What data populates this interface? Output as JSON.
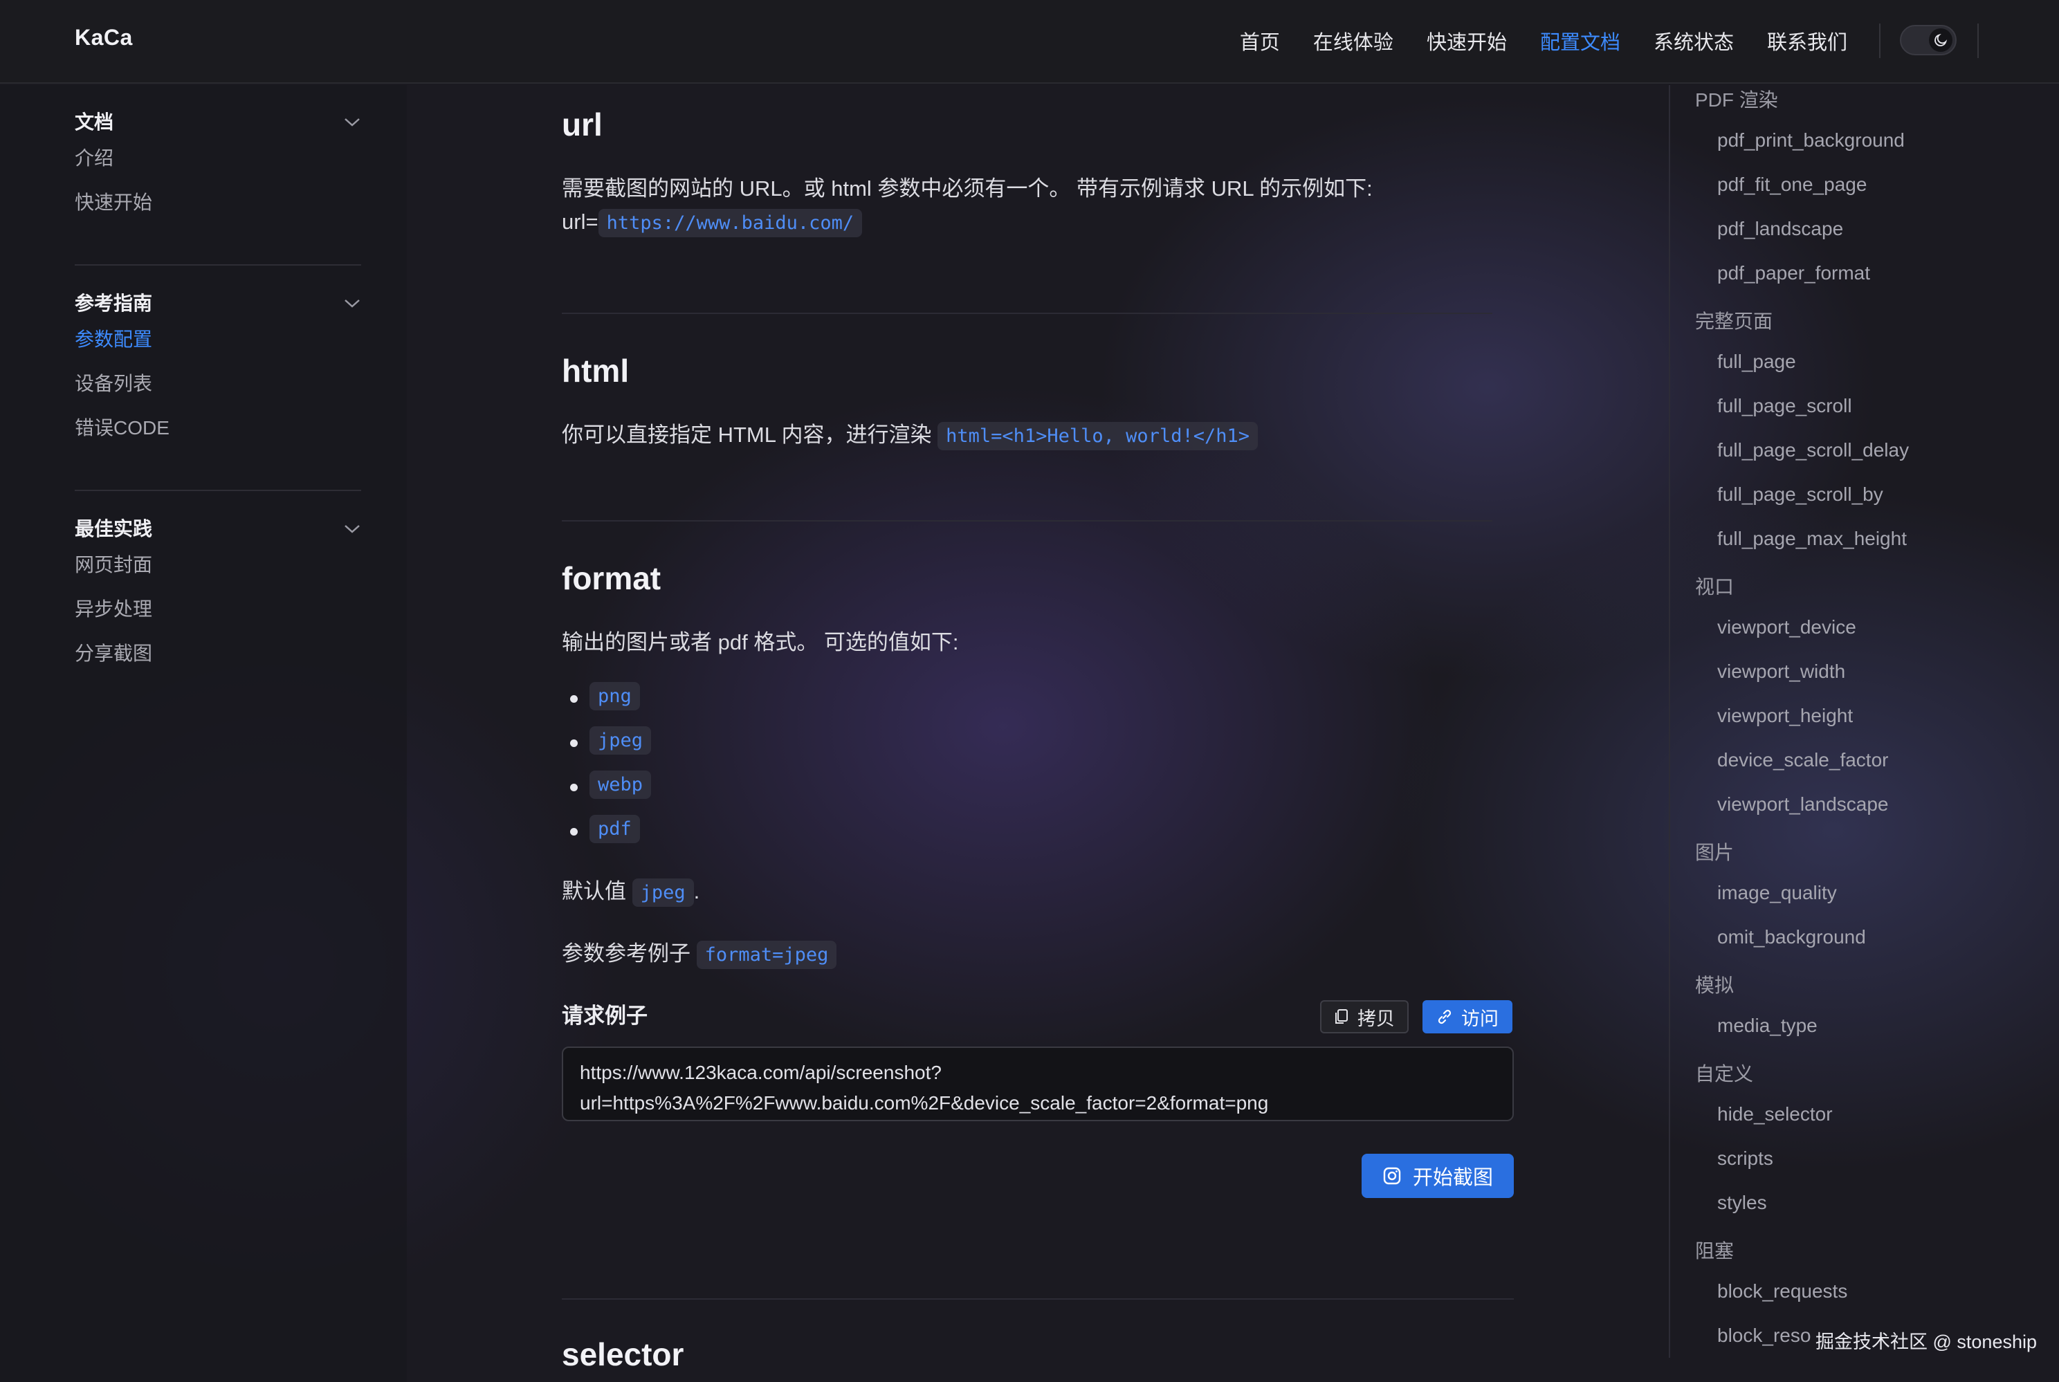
{
  "header": {
    "brand": "KaCa",
    "nav": [
      "首页",
      "在线体验",
      "快速开始",
      "配置文档",
      "系统状态",
      "联系我们"
    ],
    "active_nav": "配置文档"
  },
  "sidebar": {
    "groups": [
      {
        "title": "文档",
        "items": [
          "介绍",
          "快速开始"
        ]
      },
      {
        "title": "参考指南",
        "items": [
          "参数配置",
          "设备列表",
          "错误CODE"
        ],
        "active": "参数配置"
      },
      {
        "title": "最佳实践",
        "items": [
          "网页封面",
          "异步处理",
          "分享截图"
        ]
      }
    ]
  },
  "main": {
    "url_section": {
      "title": "url",
      "desc": "需要截图的网站的 URL。或 html 参数中必须有一个。 带有示例请求 URL 的示例如下:",
      "example_prefix": "url=",
      "example_code": "https://www.baidu.com/"
    },
    "html_section": {
      "title": "html",
      "desc": "你可以直接指定 HTML 内容，进行渲染",
      "code": "html=<h1>Hello, world!</h1>"
    },
    "format_section": {
      "title": "format",
      "desc": "输出的图片或者 pdf 格式。 可选的值如下:",
      "options": [
        "png",
        "jpeg",
        "webp",
        "pdf"
      ],
      "default_label": "默认值",
      "default_value": "jpeg",
      "default_suffix": ".",
      "example_label": "参数参考例子",
      "example_code": "format=jpeg",
      "request_title": "请求例子",
      "copy_label": "拷贝",
      "visit_label": "访问",
      "request_url_line1": "https://www.123kaca.com/api/screenshot?",
      "request_url_line2": "url=https%3A%2F%2Fwww.baidu.com%2F&device_scale_factor=2&format=png",
      "start_label": "开始截图"
    },
    "selector_section": {
      "title": "selector"
    }
  },
  "toc": {
    "entries": [
      {
        "type": "cat",
        "label": "PDF 渲染"
      },
      {
        "type": "item",
        "label": "pdf_print_background"
      },
      {
        "type": "item",
        "label": "pdf_fit_one_page"
      },
      {
        "type": "item",
        "label": "pdf_landscape"
      },
      {
        "type": "item",
        "label": "pdf_paper_format"
      },
      {
        "type": "cat",
        "label": "完整页面"
      },
      {
        "type": "item",
        "label": "full_page"
      },
      {
        "type": "item",
        "label": "full_page_scroll"
      },
      {
        "type": "item",
        "label": "full_page_scroll_delay"
      },
      {
        "type": "item",
        "label": "full_page_scroll_by"
      },
      {
        "type": "item",
        "label": "full_page_max_height"
      },
      {
        "type": "cat",
        "label": "视口"
      },
      {
        "type": "item",
        "label": "viewport_device"
      },
      {
        "type": "item",
        "label": "viewport_width"
      },
      {
        "type": "item",
        "label": "viewport_height"
      },
      {
        "type": "item",
        "label": "device_scale_factor"
      },
      {
        "type": "item",
        "label": "viewport_landscape"
      },
      {
        "type": "cat",
        "label": "图片"
      },
      {
        "type": "item",
        "label": "image_quality"
      },
      {
        "type": "item",
        "label": "omit_background"
      },
      {
        "type": "cat",
        "label": "模拟"
      },
      {
        "type": "item",
        "label": "media_type"
      },
      {
        "type": "cat",
        "label": "自定义"
      },
      {
        "type": "item",
        "label": "hide_selector"
      },
      {
        "type": "item",
        "label": "scripts"
      },
      {
        "type": "item",
        "label": "styles"
      },
      {
        "type": "cat",
        "label": "阻塞"
      },
      {
        "type": "item",
        "label": "block_requests"
      },
      {
        "type": "item",
        "label": "block_reso"
      }
    ]
  },
  "watermark": "掘金技术社区 @ stoneship",
  "colors": {
    "accent": "#3d8bff",
    "button": "#2a6fe0",
    "background": "#1b1a21"
  }
}
